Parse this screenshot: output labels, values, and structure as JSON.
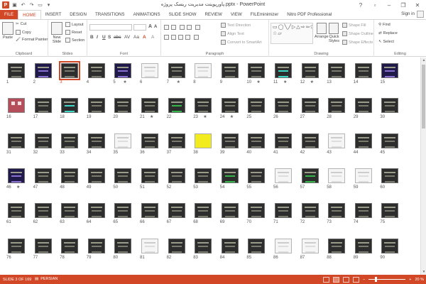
{
  "title_bar": {
    "app_icon_letter": "P",
    "title": "پاورپوینت مدیریت ریسک پروژه.pptx - PowerPoint",
    "controls": {
      "help": "?",
      "ribbon_options": "▫",
      "minimize": "–",
      "restore": "❐",
      "close": "✕"
    }
  },
  "ribbon_tabs": [
    {
      "label": "FILE"
    },
    {
      "label": "HOME"
    },
    {
      "label": "INSERT"
    },
    {
      "label": "DESIGN"
    },
    {
      "label": "TRANSITIONS"
    },
    {
      "label": "ANIMATIONS"
    },
    {
      "label": "SLIDE SHOW"
    },
    {
      "label": "REVIEW"
    },
    {
      "label": "VIEW"
    },
    {
      "label": "FILEminimizer"
    },
    {
      "label": "Nitro PDF Professional"
    }
  ],
  "active_tab": "HOME",
  "sign_in": "Sign in",
  "clipboard": {
    "paste": "Paste",
    "cut": "Cut",
    "copy": "Copy",
    "format_painter": "Format Painter",
    "label": "Clipboard"
  },
  "slides_group": {
    "new_slide": "New",
    "new_slide_2": "Slide",
    "layout": "Layout",
    "reset": "Reset",
    "section": "Section",
    "label": "Slides"
  },
  "font_group": {
    "font_name": "",
    "font_size": "",
    "bold": "B",
    "italic": "I",
    "underline": "U",
    "strike": "S",
    "shadow": "abc",
    "spacing": "AV",
    "case": "Aa",
    "color": "A",
    "grow": "A",
    "shrink": "A",
    "clear": "A",
    "label": "Font"
  },
  "paragraph_group": {
    "text_direction": "Text Direction",
    "align_text": "Align Text",
    "convert_smartart": "Convert to SmartArt",
    "label": "Paragraph"
  },
  "drawing_group": {
    "arrange": "Arrange",
    "quick_styles": "Quick",
    "quick_styles_2": "Styles",
    "shape_fill": "Shape Fill",
    "shape_outline": "Shape Outline",
    "shape_effects": "Shape Effects",
    "shapes_preview": "▭◯╲╱▷△⇨⇦⬠◇▯⌒{}☆▱",
    "label": "Drawing"
  },
  "editing_group": {
    "find": "Find",
    "replace": "Replace",
    "select": "Select",
    "label": "Editing"
  },
  "slides": [
    {
      "n": "1"
    },
    {
      "n": "2",
      "style": "purple"
    },
    {
      "n": "3",
      "selected": true
    },
    {
      "n": "4"
    },
    {
      "n": "5",
      "star": true,
      "style": "purple"
    },
    {
      "n": "6",
      "style": "white"
    },
    {
      "n": "7",
      "star": true
    },
    {
      "n": "8",
      "style": "white"
    },
    {
      "n": "9"
    },
    {
      "n": "10",
      "star": true
    },
    {
      "n": "11",
      "star": true,
      "style": "teal"
    },
    {
      "n": "12",
      "star": true
    },
    {
      "n": "13"
    },
    {
      "n": "14"
    },
    {
      "n": "15",
      "style": "purple"
    },
    {
      "n": "16",
      "style": "pink"
    },
    {
      "n": "17"
    },
    {
      "n": "18",
      "style": "teal"
    },
    {
      "n": "19"
    },
    {
      "n": "20"
    },
    {
      "n": "21",
      "star": true
    },
    {
      "n": "22",
      "style": "green"
    },
    {
      "n": "23",
      "star": true
    },
    {
      "n": "24",
      "star": true
    },
    {
      "n": "25"
    },
    {
      "n": "26"
    },
    {
      "n": "27"
    },
    {
      "n": "28"
    },
    {
      "n": "29"
    },
    {
      "n": "30"
    },
    {
      "n": "31"
    },
    {
      "n": "32"
    },
    {
      "n": "33"
    },
    {
      "n": "34"
    },
    {
      "n": "35",
      "style": "white"
    },
    {
      "n": "36"
    },
    {
      "n": "37"
    },
    {
      "n": "38",
      "style": "yellow"
    },
    {
      "n": "39"
    },
    {
      "n": "40"
    },
    {
      "n": "41"
    },
    {
      "n": "42"
    },
    {
      "n": "43",
      "style": "white"
    },
    {
      "n": "44"
    },
    {
      "n": "45"
    },
    {
      "n": "46",
      "star": true,
      "style": "purple"
    },
    {
      "n": "47"
    },
    {
      "n": "48"
    },
    {
      "n": "49"
    },
    {
      "n": "50"
    },
    {
      "n": "51"
    },
    {
      "n": "52"
    },
    {
      "n": "53"
    },
    {
      "n": "54",
      "style": "green"
    },
    {
      "n": "55"
    },
    {
      "n": "56",
      "style": "white"
    },
    {
      "n": "57",
      "style": "green"
    },
    {
      "n": "58",
      "style": "white"
    },
    {
      "n": "59",
      "style": "white"
    },
    {
      "n": "60"
    },
    {
      "n": "61"
    },
    {
      "n": "62"
    },
    {
      "n": "63"
    },
    {
      "n": "64"
    },
    {
      "n": "65"
    },
    {
      "n": "66"
    },
    {
      "n": "67"
    },
    {
      "n": "68"
    },
    {
      "n": "69"
    },
    {
      "n": "70"
    },
    {
      "n": "71"
    },
    {
      "n": "72"
    },
    {
      "n": "73"
    },
    {
      "n": "74"
    },
    {
      "n": "75"
    },
    {
      "n": "76"
    },
    {
      "n": "77"
    },
    {
      "n": "78"
    },
    {
      "n": "79"
    },
    {
      "n": "80"
    },
    {
      "n": "81",
      "style": "white"
    },
    {
      "n": "82"
    },
    {
      "n": "83"
    },
    {
      "n": "84"
    },
    {
      "n": "85"
    },
    {
      "n": "86",
      "style": "white"
    },
    {
      "n": "87",
      "style": "white"
    },
    {
      "n": "88"
    },
    {
      "n": "89"
    },
    {
      "n": "90"
    }
  ],
  "status_bar": {
    "slide_info": "SLIDE 3 OF 169",
    "language": "PERSIAN",
    "zoom": "20 %",
    "zoom_level_fraction": 0.2
  },
  "colors": {
    "accent": "#d24726",
    "status_bar": "#d24726"
  }
}
